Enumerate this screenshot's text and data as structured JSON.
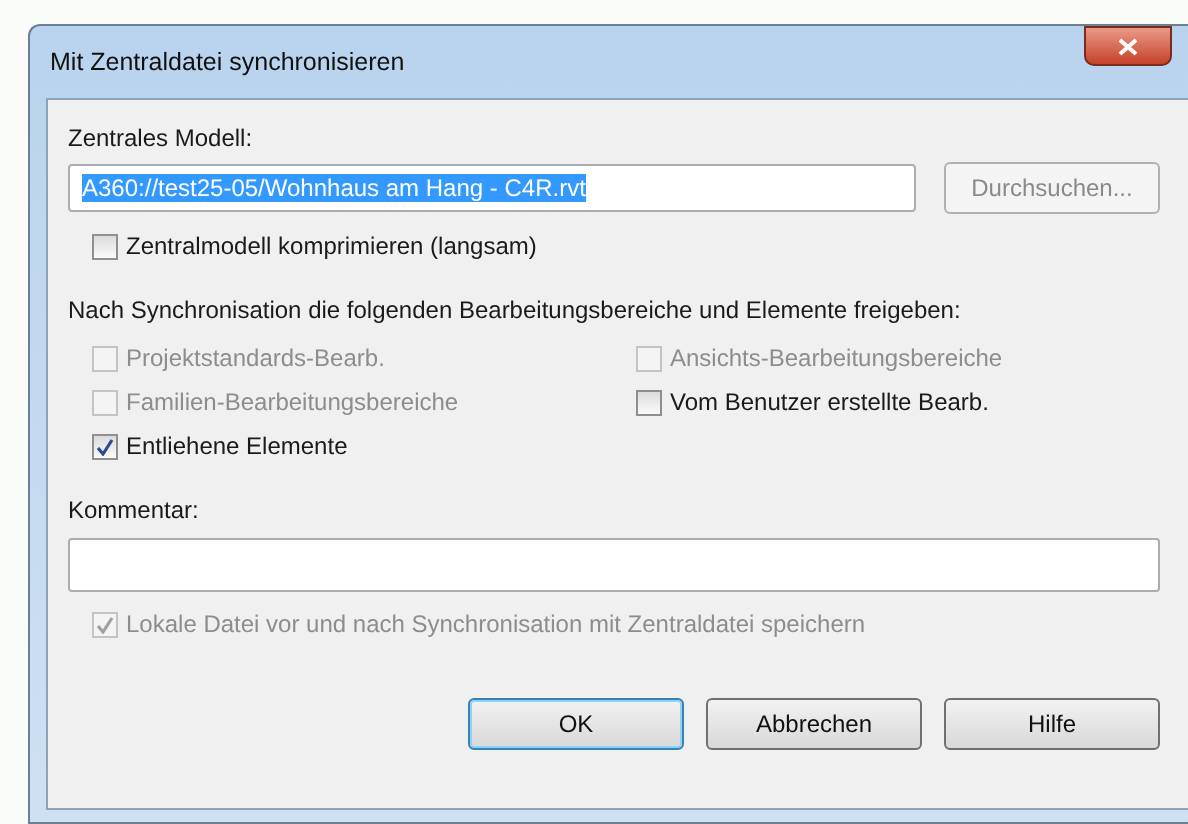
{
  "window": {
    "title": "Mit Zentraldatei synchronisieren"
  },
  "central_model": {
    "label": "Zentrales Modell:",
    "value": "A360://test25-05/Wohnhaus am Hang - C4R.rvt",
    "browse_button": {
      "label": "Durchsuchen...",
      "disabled": true
    }
  },
  "compress": {
    "label": "Zentralmodell komprimieren (langsam)",
    "checked": false,
    "disabled": false
  },
  "release": {
    "heading": "Nach Synchronisation die folgenden Bearbeitungsbereiche und Elemente freigeben:",
    "options": [
      {
        "label": "Projektstandards-Bearb.",
        "checked": false,
        "disabled": true
      },
      {
        "label": "Ansichts-Bearbeitungsbereiche",
        "checked": false,
        "disabled": true
      },
      {
        "label": "Familien-Bearbeitungsbereiche",
        "checked": false,
        "disabled": true
      },
      {
        "label": "Vom Benutzer erstellte Bearb.",
        "checked": false,
        "disabled": false
      },
      {
        "label": "Entliehene Elemente",
        "checked": true,
        "disabled": false
      }
    ]
  },
  "comment": {
    "label": "Kommentar:"
  },
  "save_local": {
    "label": "Lokale Datei vor und nach Synchronisation mit Zentraldatei speichern",
    "checked": true,
    "disabled": true
  },
  "buttons": [
    {
      "label": "OK",
      "default": true
    },
    {
      "label": "Abbrechen",
      "default": false
    },
    {
      "label": "Hilfe",
      "default": false
    }
  ]
}
